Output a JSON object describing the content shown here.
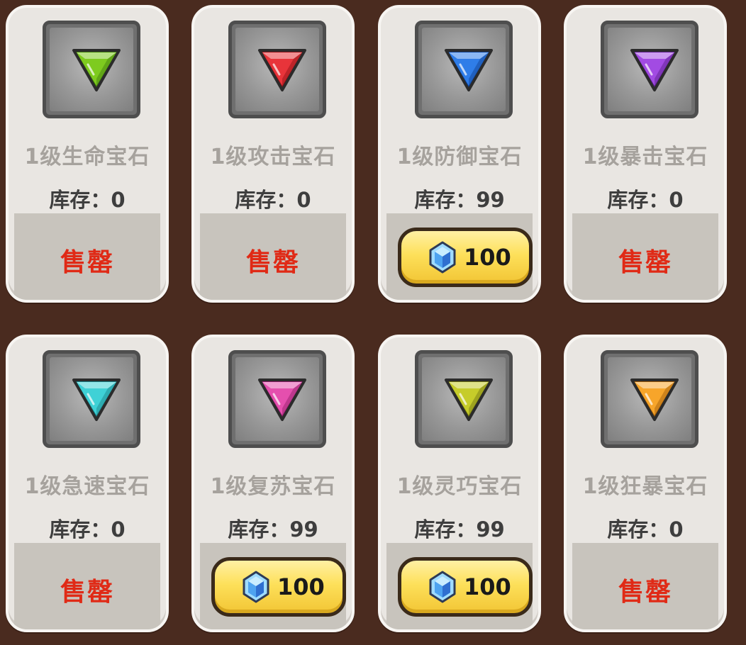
{
  "stock_label": "库存：",
  "sold_out_label": "售罄",
  "currency_icon": "blue-crystal-icon",
  "items": [
    {
      "name": "1级生命宝石",
      "stock": "0",
      "sold_out": true,
      "color": "#7ecb1f",
      "dark": "#3e7a0d"
    },
    {
      "name": "1级攻击宝石",
      "stock": "0",
      "sold_out": true,
      "color": "#e8343a",
      "dark": "#8a1217"
    },
    {
      "name": "1级防御宝石",
      "stock": "99",
      "sold_out": false,
      "price": "100",
      "color": "#2f7de8",
      "dark": "#103f8d"
    },
    {
      "name": "1级暴击宝石",
      "stock": "0",
      "sold_out": true,
      "color": "#a24be3",
      "dark": "#561c86"
    },
    {
      "name": "1级急速宝石",
      "stock": "0",
      "sold_out": true,
      "color": "#3fd1d6",
      "dark": "#1a7f86"
    },
    {
      "name": "1级复苏宝石",
      "stock": "99",
      "sold_out": false,
      "price": "100",
      "color": "#e54fae",
      "dark": "#8b1c66"
    },
    {
      "name": "1级灵巧宝石",
      "stock": "99",
      "sold_out": false,
      "price": "100",
      "color": "#c6cc2a",
      "dark": "#6d7111"
    },
    {
      "name": "1级狂暴宝石",
      "stock": "0",
      "sold_out": true,
      "color": "#f7a52a",
      "dark": "#9c5a0a"
    }
  ]
}
